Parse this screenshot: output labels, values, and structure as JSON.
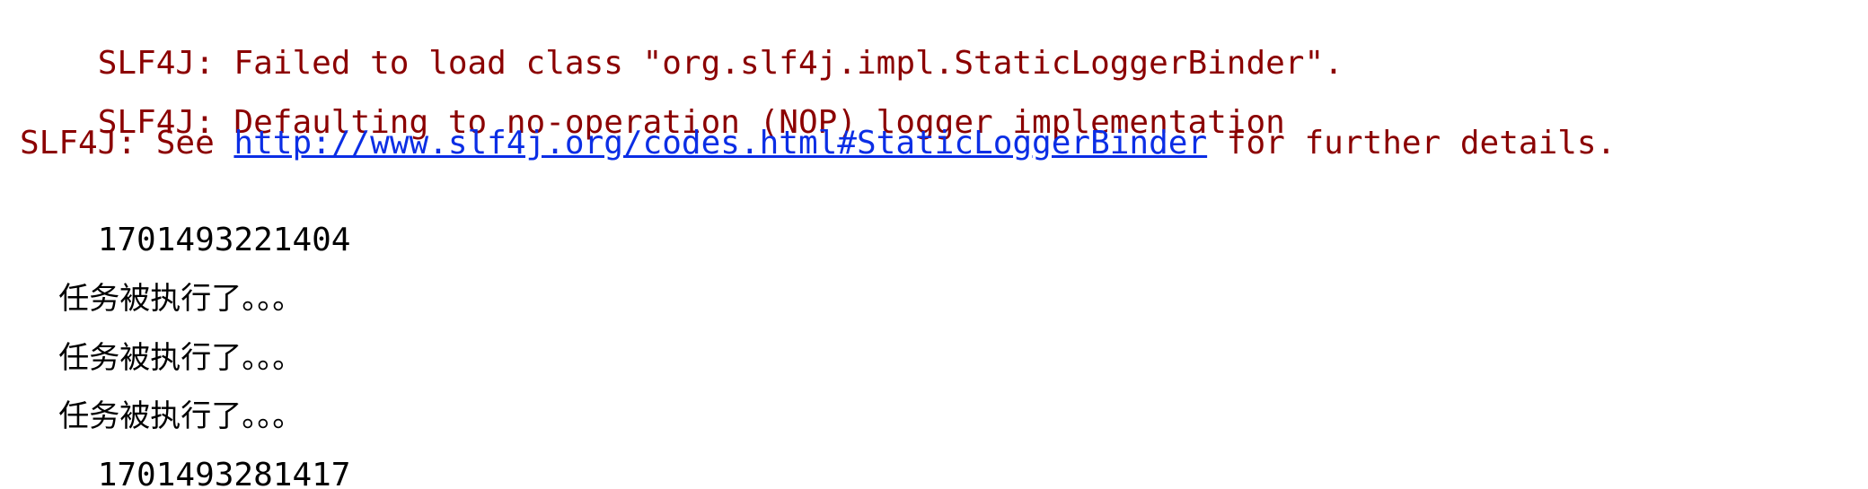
{
  "console": {
    "lines": [
      {
        "type": "stderr",
        "text": "SLF4J: Failed to load class \"org.slf4j.impl.StaticLoggerBinder\"."
      },
      {
        "type": "stderr",
        "text": "SLF4J: Defaulting to no-operation (NOP) logger implementation"
      },
      {
        "type": "stderr",
        "prefix": "SLF4J: See ",
        "link": "http://www.slf4j.org/codes.html#StaticLoggerBinder",
        "suffix": " for further details."
      },
      {
        "type": "stdout",
        "text": "1701493221404"
      },
      {
        "type": "stdout",
        "text": "任务被执行了。。。"
      },
      {
        "type": "stdout",
        "text": "任务被执行了。。。"
      },
      {
        "type": "stdout",
        "text": "任务被执行了。。。"
      },
      {
        "type": "stdout",
        "text": "1701493281417"
      }
    ]
  },
  "colors": {
    "stderr": "#8b0000",
    "stdout": "#000000",
    "link": "#0b2ee5",
    "background": "#ffffff"
  }
}
